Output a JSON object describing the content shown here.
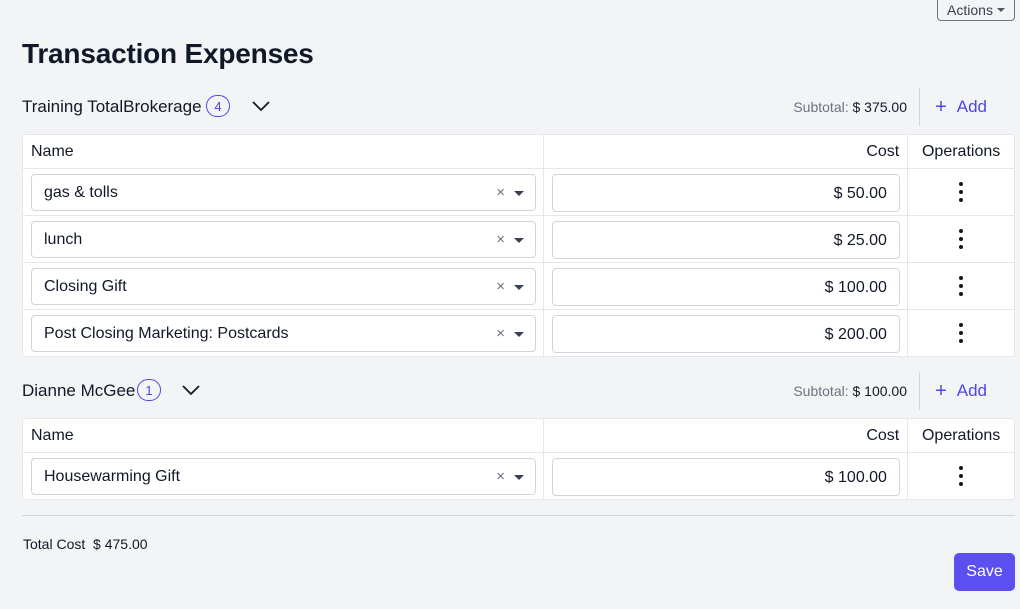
{
  "actions_label": "Actions",
  "page_title": "Transaction Expenses",
  "columns": {
    "name": "Name",
    "cost": "Cost",
    "operations": "Operations"
  },
  "groups": [
    {
      "name": "Training TotalBrokerage",
      "count": "4",
      "subtotal_label": "Subtotal:",
      "subtotal_value": "$ 375.00",
      "add_label": "Add",
      "items": [
        {
          "name": "gas & tolls",
          "cost": "$ 50.00"
        },
        {
          "name": "lunch",
          "cost": "$ 25.00"
        },
        {
          "name": "Closing Gift",
          "cost": "$ 100.00"
        },
        {
          "name": "Post Closing Marketing: Postcards",
          "cost": "$ 200.00"
        }
      ]
    },
    {
      "name": "Dianne McGee",
      "count": "1",
      "subtotal_label": "Subtotal:",
      "subtotal_value": "$ 100.00",
      "add_label": "Add",
      "items": [
        {
          "name": "Housewarming Gift",
          "cost": "$ 100.00"
        }
      ]
    }
  ],
  "total_label": "Total Cost",
  "total_value": "$ 475.00",
  "save_label": "Save",
  "colors": {
    "accent": "#4f46e5",
    "save_bg": "#5b4ff0",
    "background": "#f3f4f6"
  }
}
